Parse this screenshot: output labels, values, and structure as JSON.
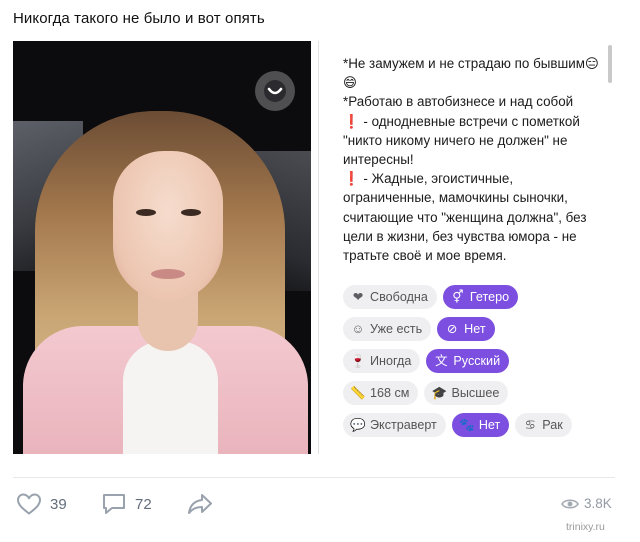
{
  "post": {
    "title": "Никогда такого не было и вот опять"
  },
  "profile": {
    "bio": "*Не замужем и не страдаю по бывшим😑😄\n*Работаю в автобизнесе и над собой\n❗ - однодневные встречи с пометкой \"никто никому ничего не должен\" не интересны!\n❗ - Жадные, эгоистичные, ограниченные, мамочкины сыночки, считающие что \"женщина должна\", без цели в жизни, без чувства юмора - не тратьте своё и мое время.",
    "chips": [
      [
        {
          "label": "Свободна",
          "icon": "heart-icon",
          "glyph": "❤",
          "style": "grey"
        },
        {
          "label": "Гетеро",
          "icon": "gender-icon",
          "glyph": "⚥",
          "style": "purple"
        }
      ],
      [
        {
          "label": "Уже есть",
          "icon": "baby-icon",
          "glyph": "☺",
          "style": "grey"
        },
        {
          "label": "Нет",
          "icon": "smoking-icon",
          "glyph": "⊘",
          "style": "purple"
        }
      ],
      [
        {
          "label": "Иногда",
          "icon": "wine-glass-icon",
          "glyph": "🍷",
          "style": "grey"
        },
        {
          "label": "Русский",
          "icon": "language-icon",
          "glyph": "文",
          "style": "purple"
        }
      ],
      [
        {
          "label": "168 см",
          "icon": "ruler-icon",
          "glyph": "📏",
          "style": "grey"
        },
        {
          "label": "Высшее",
          "icon": "graduation-cap-icon",
          "glyph": "🎓",
          "style": "grey"
        }
      ],
      [
        {
          "label": "Экстраверт",
          "icon": "speech-bubble-icon",
          "glyph": "💬",
          "style": "grey"
        },
        {
          "label": "Нет",
          "icon": "paw-icon",
          "glyph": "🐾",
          "style": "purple"
        },
        {
          "label": "Рак",
          "icon": "zodiac-icon",
          "glyph": "♋",
          "style": "grey"
        }
      ]
    ]
  },
  "footer": {
    "likes": "39",
    "comments": "72",
    "views": "3.8K",
    "watermark": "trinixy.ru"
  },
  "colors": {
    "accent": "#7c4fe0",
    "chip_grey": "#efeff1",
    "action_grey": "#626d7a"
  }
}
